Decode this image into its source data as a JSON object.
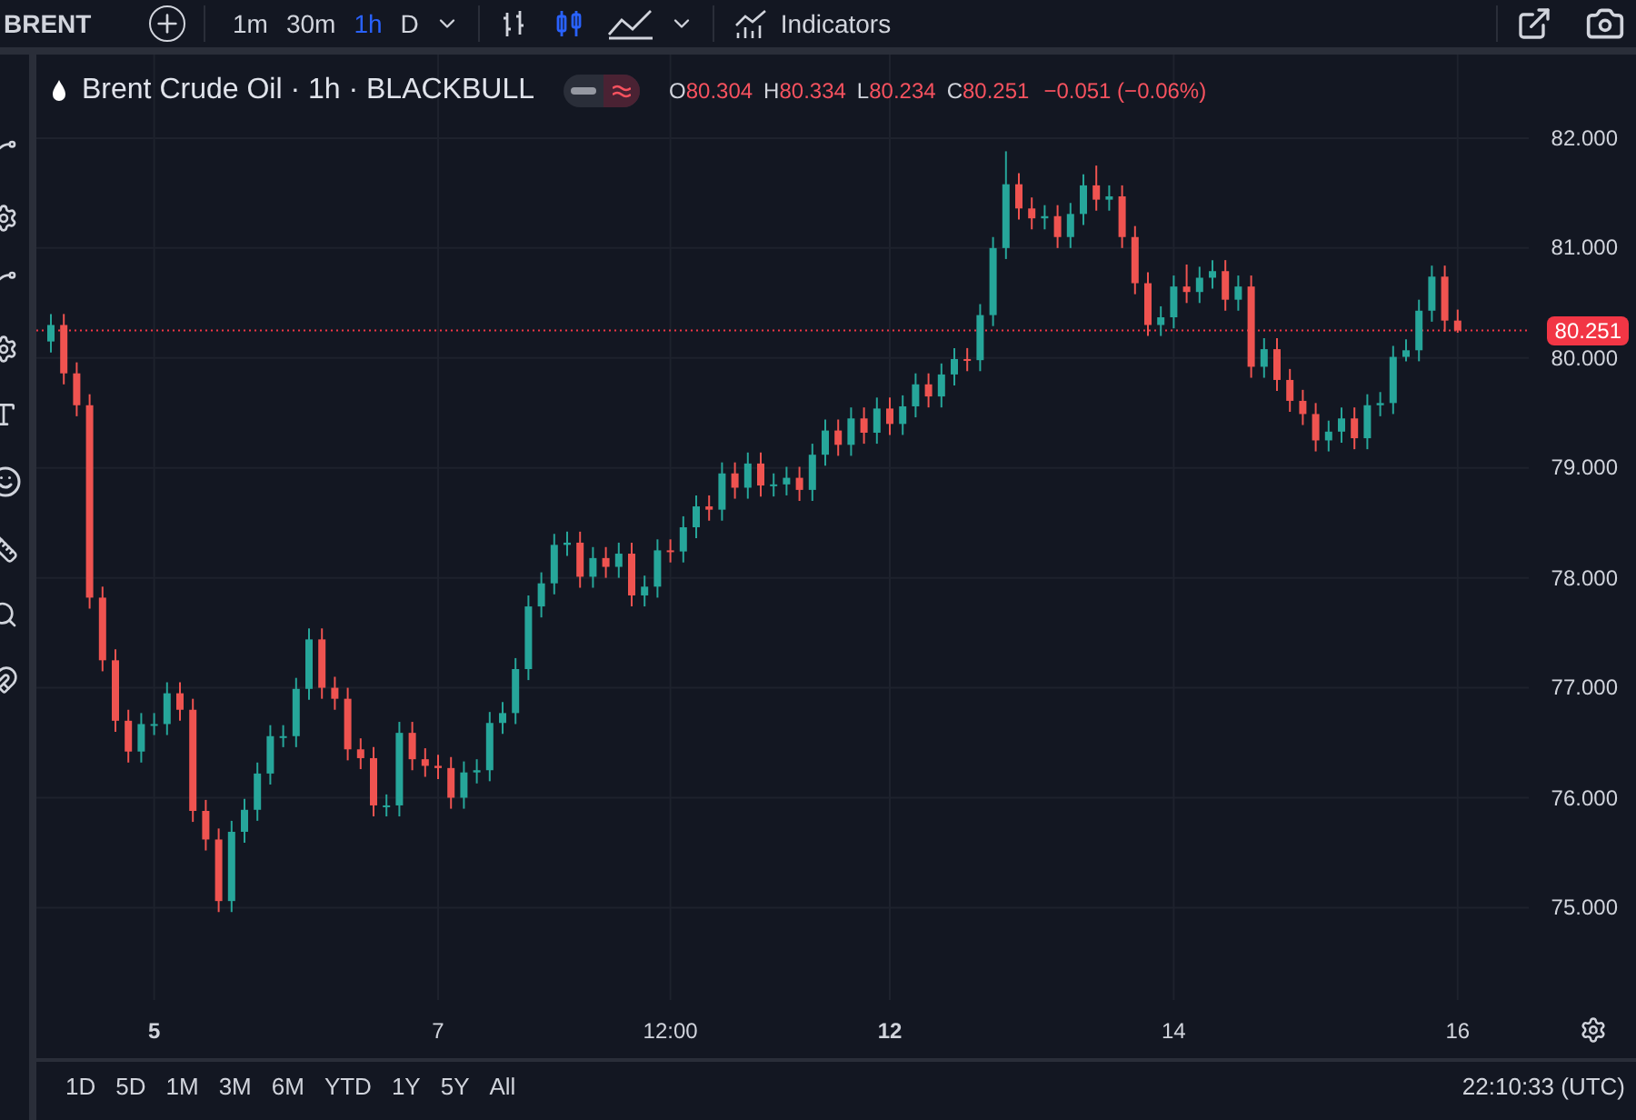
{
  "toolbar": {
    "symbol": "BRENT",
    "intervals": [
      {
        "label": "1m",
        "selected": false
      },
      {
        "label": "30m",
        "selected": false
      },
      {
        "label": "1h",
        "selected": true
      },
      {
        "label": "D",
        "selected": false
      }
    ],
    "chart_styles": [
      {
        "kind": "bars",
        "selected": false
      },
      {
        "kind": "candles",
        "selected": true
      },
      {
        "kind": "area",
        "selected": false
      }
    ],
    "indicators": "Indicators"
  },
  "legend": {
    "title": "Brent Crude Oil · 1h · BLACKBULL",
    "values": [
      {
        "key": "O",
        "value": "80.304"
      },
      {
        "key": "H",
        "value": "80.334"
      },
      {
        "key": "L",
        "value": "80.234"
      },
      {
        "key": "C",
        "value": "80.251"
      }
    ],
    "change": "−0.051 (−0.06%)"
  },
  "chart": {
    "chart_data": {
      "type": "candlestick",
      "grid": true,
      "ref_lines": [
        {
          "axis": "y",
          "value": 80.251,
          "label": "80.251",
          "color": "#f23645"
        }
      ],
      "categories": [
        null,
        null,
        null,
        null,
        null,
        null,
        null,
        null,
        "5",
        null,
        null,
        null,
        null,
        null,
        null,
        null,
        null,
        null,
        null,
        null,
        null,
        null,
        null,
        null,
        null,
        null,
        null,
        null,
        null,
        null,
        "7",
        null,
        null,
        null,
        null,
        null,
        null,
        null,
        null,
        null,
        null,
        null,
        null,
        null,
        null,
        null,
        null,
        null,
        "12:00",
        null,
        null,
        null,
        null,
        null,
        null,
        null,
        null,
        null,
        null,
        null,
        null,
        null,
        null,
        null,
        null,
        "12",
        null,
        null,
        null,
        null,
        null,
        null,
        null,
        null,
        null,
        null,
        null,
        null,
        null,
        null,
        null,
        null,
        null,
        null,
        null,
        null,
        null,
        "14",
        null,
        null,
        null,
        null,
        null,
        null,
        null,
        null,
        null,
        null,
        null,
        null,
        null,
        null,
        null,
        null,
        null,
        null,
        null,
        null,
        null,
        "16"
      ],
      "ylim": [
        74.16,
        82.76
      ],
      "ohlc": [
        [
          80.15,
          80.4,
          80.05,
          80.3
        ],
        [
          80.3,
          80.4,
          79.76,
          79.86
        ],
        [
          79.86,
          79.96,
          79.47,
          79.57
        ],
        [
          79.57,
          79.67,
          77.72,
          77.82
        ],
        [
          77.82,
          77.92,
          77.15,
          77.25
        ],
        [
          77.25,
          77.35,
          76.6,
          76.7
        ],
        [
          76.7,
          76.8,
          76.32,
          76.42
        ],
        [
          76.42,
          76.77,
          76.32,
          76.67
        ],
        [
          76.67,
          76.77,
          76.57,
          76.67
        ],
        [
          76.67,
          77.05,
          76.57,
          76.95
        ],
        [
          76.95,
          77.05,
          76.7,
          76.8
        ],
        [
          76.8,
          76.9,
          75.78,
          75.88
        ],
        [
          75.88,
          75.98,
          75.52,
          75.62
        ],
        [
          75.62,
          75.72,
          74.96,
          75.06
        ],
        [
          75.06,
          75.79,
          74.96,
          75.69
        ],
        [
          75.69,
          75.99,
          75.59,
          75.89
        ],
        [
          75.89,
          76.32,
          75.79,
          76.22
        ],
        [
          76.22,
          76.66,
          76.12,
          76.56
        ],
        [
          76.56,
          76.66,
          76.46,
          76.56
        ],
        [
          76.56,
          77.09,
          76.46,
          76.99
        ],
        [
          76.99,
          77.54,
          76.89,
          77.44
        ],
        [
          77.44,
          77.54,
          76.9,
          77.0
        ],
        [
          77.0,
          77.1,
          76.8,
          76.9
        ],
        [
          76.9,
          77.0,
          76.34,
          76.44
        ],
        [
          76.44,
          76.54,
          76.26,
          76.36
        ],
        [
          76.36,
          76.46,
          75.83,
          75.93
        ],
        [
          75.93,
          76.03,
          75.83,
          75.93
        ],
        [
          75.93,
          76.69,
          75.83,
          76.59
        ],
        [
          76.59,
          76.69,
          76.25,
          76.35
        ],
        [
          76.35,
          76.45,
          76.19,
          76.29
        ],
        [
          76.29,
          76.39,
          76.17,
          76.27
        ],
        [
          76.27,
          76.37,
          75.9,
          76.0
        ],
        [
          76.0,
          76.33,
          75.9,
          76.23
        ],
        [
          76.23,
          76.35,
          76.13,
          76.25
        ],
        [
          76.25,
          76.78,
          76.15,
          76.68
        ],
        [
          76.68,
          76.87,
          76.58,
          76.77
        ],
        [
          76.77,
          77.27,
          76.67,
          77.17
        ],
        [
          77.17,
          77.84,
          77.07,
          77.74
        ],
        [
          77.74,
          78.05,
          77.64,
          77.95
        ],
        [
          77.95,
          78.4,
          77.85,
          78.3
        ],
        [
          78.3,
          78.42,
          78.2,
          78.32
        ],
        [
          78.32,
          78.42,
          77.91,
          78.01
        ],
        [
          78.01,
          78.28,
          77.91,
          78.18
        ],
        [
          78.18,
          78.28,
          78.0,
          78.1
        ],
        [
          78.1,
          78.32,
          78.0,
          78.22
        ],
        [
          78.22,
          78.32,
          77.74,
          77.84
        ],
        [
          77.84,
          78.02,
          77.74,
          77.92
        ],
        [
          77.92,
          78.35,
          77.82,
          78.25
        ],
        [
          78.25,
          78.35,
          78.14,
          78.24
        ],
        [
          78.24,
          78.56,
          78.14,
          78.46
        ],
        [
          78.46,
          78.75,
          78.36,
          78.65
        ],
        [
          78.65,
          78.75,
          78.52,
          78.62
        ],
        [
          78.62,
          79.05,
          78.52,
          78.95
        ],
        [
          78.95,
          79.05,
          78.72,
          78.82
        ],
        [
          78.82,
          79.14,
          78.72,
          79.04
        ],
        [
          79.04,
          79.14,
          78.74,
          78.84
        ],
        [
          78.84,
          78.95,
          78.74,
          78.85
        ],
        [
          78.85,
          79.01,
          78.75,
          78.91
        ],
        [
          78.91,
          79.01,
          78.7,
          78.8
        ],
        [
          78.8,
          79.22,
          78.7,
          79.12
        ],
        [
          79.12,
          79.44,
          79.02,
          79.34
        ],
        [
          79.34,
          79.44,
          79.11,
          79.21
        ],
        [
          79.21,
          79.55,
          79.11,
          79.45
        ],
        [
          79.45,
          79.55,
          79.22,
          79.32
        ],
        [
          79.32,
          79.64,
          79.22,
          79.54
        ],
        [
          79.54,
          79.64,
          79.3,
          79.4
        ],
        [
          79.4,
          79.66,
          79.3,
          79.56
        ],
        [
          79.56,
          79.86,
          79.46,
          79.76
        ],
        [
          79.76,
          79.86,
          79.55,
          79.65
        ],
        [
          79.65,
          79.95,
          79.55,
          79.85
        ],
        [
          79.85,
          80.09,
          79.75,
          79.99
        ],
        [
          79.99,
          80.09,
          79.88,
          79.98
        ],
        [
          79.98,
          80.49,
          79.88,
          80.39
        ],
        [
          80.39,
          81.1,
          80.29,
          81.0
        ],
        [
          81.0,
          81.88,
          80.9,
          81.58
        ],
        [
          81.58,
          81.68,
          81.26,
          81.36
        ],
        [
          81.36,
          81.46,
          81.17,
          81.27
        ],
        [
          81.27,
          81.39,
          81.17,
          81.29
        ],
        [
          81.29,
          81.39,
          81.0,
          81.1
        ],
        [
          81.1,
          81.41,
          81.0,
          81.31
        ],
        [
          81.31,
          81.67,
          81.21,
          81.57
        ],
        [
          81.57,
          81.75,
          81.34,
          81.44
        ],
        [
          81.44,
          81.57,
          81.34,
          81.47
        ],
        [
          81.47,
          81.57,
          81.0,
          81.1
        ],
        [
          81.1,
          81.2,
          80.58,
          80.68
        ],
        [
          80.68,
          80.78,
          80.2,
          80.3
        ],
        [
          80.3,
          80.47,
          80.2,
          80.37
        ],
        [
          80.37,
          80.75,
          80.27,
          80.65
        ],
        [
          80.65,
          80.85,
          80.5,
          80.6
        ],
        [
          80.6,
          80.83,
          80.5,
          80.73
        ],
        [
          80.73,
          80.89,
          80.63,
          80.79
        ],
        [
          80.79,
          80.89,
          80.43,
          80.53
        ],
        [
          80.53,
          80.75,
          80.43,
          80.65
        ],
        [
          80.65,
          80.75,
          79.82,
          79.92
        ],
        [
          79.92,
          80.18,
          79.82,
          80.08
        ],
        [
          80.08,
          80.18,
          79.7,
          79.8
        ],
        [
          79.8,
          79.9,
          79.51,
          79.61
        ],
        [
          79.61,
          79.71,
          79.39,
          79.49
        ],
        [
          79.49,
          79.59,
          79.15,
          79.25
        ],
        [
          79.25,
          79.43,
          79.15,
          79.33
        ],
        [
          79.33,
          79.55,
          79.23,
          79.45
        ],
        [
          79.45,
          79.55,
          79.17,
          79.27
        ],
        [
          79.27,
          79.67,
          79.17,
          79.57
        ],
        [
          79.57,
          79.69,
          79.47,
          79.59
        ],
        [
          79.59,
          80.11,
          79.49,
          80.01
        ],
        [
          80.01,
          80.17,
          79.97,
          80.07
        ],
        [
          80.07,
          80.53,
          79.97,
          80.43
        ],
        [
          80.43,
          80.84,
          80.33,
          80.74
        ],
        [
          80.74,
          80.84,
          80.24,
          80.34
        ],
        [
          80.34,
          80.44,
          80.23,
          80.25
        ]
      ],
      "yticks": [
        {
          "value": 82,
          "label": "82.000"
        },
        {
          "value": 81,
          "label": "81.000"
        },
        {
          "value": 80,
          "label": "80.000"
        },
        {
          "value": 79,
          "label": "79.000"
        },
        {
          "value": 78,
          "label": "78.000"
        },
        {
          "value": 77,
          "label": "77.000"
        },
        {
          "value": 76,
          "label": "76.000"
        },
        {
          "value": 75,
          "label": "75.000"
        }
      ]
    },
    "time_label_bold": [
      true,
      false,
      false,
      true,
      false,
      false
    ]
  },
  "ranges": [
    "1D",
    "5D",
    "1M",
    "3M",
    "6M",
    "YTD",
    "1Y",
    "5Y",
    "All"
  ],
  "clock": "22:10:33 (UTC)"
}
